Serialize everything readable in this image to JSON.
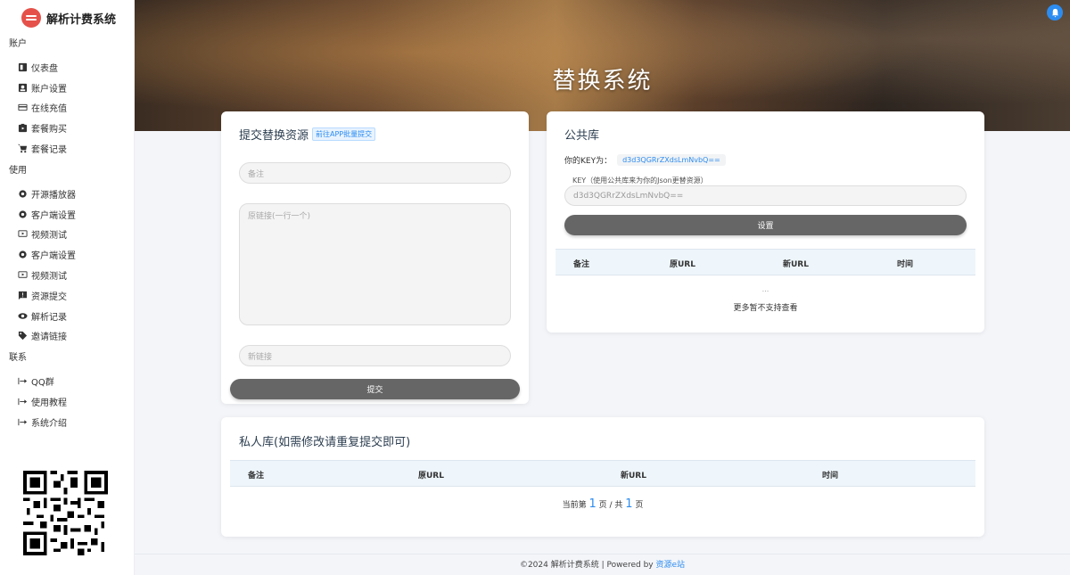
{
  "app": {
    "name": "解析计费系统"
  },
  "sidebar": {
    "sections": [
      {
        "title": "账户",
        "items": [
          {
            "label": "仪表盘",
            "icon": "dashboard-icon"
          },
          {
            "label": "账户设置",
            "icon": "account-box-icon"
          },
          {
            "label": "在线充值",
            "icon": "credit-card-icon"
          },
          {
            "label": "套餐购买",
            "icon": "package-icon"
          },
          {
            "label": "套餐记录",
            "icon": "cart-icon"
          }
        ]
      },
      {
        "title": "使用",
        "items": [
          {
            "label": "开源播放器",
            "icon": "gear-icon"
          },
          {
            "label": "客户端设置",
            "icon": "gear-icon"
          },
          {
            "label": "视频测试",
            "icon": "video-icon"
          },
          {
            "label": "客户端设置",
            "icon": "gear-icon"
          },
          {
            "label": "视频测试",
            "icon": "video-icon"
          },
          {
            "label": "资源提交",
            "icon": "feedback-icon"
          },
          {
            "label": "解析记录",
            "icon": "eye-icon"
          },
          {
            "label": "邀请链接",
            "icon": "tag-icon"
          }
        ]
      },
      {
        "title": "联系",
        "items": [
          {
            "label": "QQ群",
            "icon": "arrow-right-bar-icon"
          },
          {
            "label": "使用教程",
            "icon": "arrow-right-bar-icon"
          },
          {
            "label": "系统介绍",
            "icon": "arrow-right-bar-icon"
          }
        ]
      }
    ]
  },
  "banner": {
    "title": "替换系统"
  },
  "submit": {
    "title": "提交替换资源",
    "app_link": "前往APP批量提交",
    "note_placeholder": "备注",
    "original_placeholder": "原链接(一行一个)",
    "new_placeholder": "新链接",
    "submit_label": "提交"
  },
  "public": {
    "title": "公共库",
    "key_prefix": "你的KEY为：",
    "key_value": "d3d3QGRrZXdsLmNvbQ==",
    "key_label": "KEY（使用公共库来为你的Json更替资源）",
    "key_input_value": "d3d3QGRrZXdsLmNvbQ==",
    "set_label": "设置",
    "columns": [
      "备注",
      "原URL",
      "新URL",
      "时间"
    ],
    "ellipsis": "...",
    "more_text": "更多暂不支持查看"
  },
  "private": {
    "title": "私人库(如需修改请重复提交即可)",
    "columns": [
      "备注",
      "原URL",
      "新URL",
      "时间"
    ],
    "pager_prefix": "当前第",
    "current_page": "1",
    "pager_mid": "页 / 共",
    "total_pages": "1",
    "pager_suffix": "页"
  },
  "footer": {
    "text": "©2024 解析计费系统 | Powered by",
    "link": "资源e站"
  },
  "colors": {
    "accent": "#2d8cf0",
    "button": "#666666",
    "brand": "#e5514a"
  }
}
